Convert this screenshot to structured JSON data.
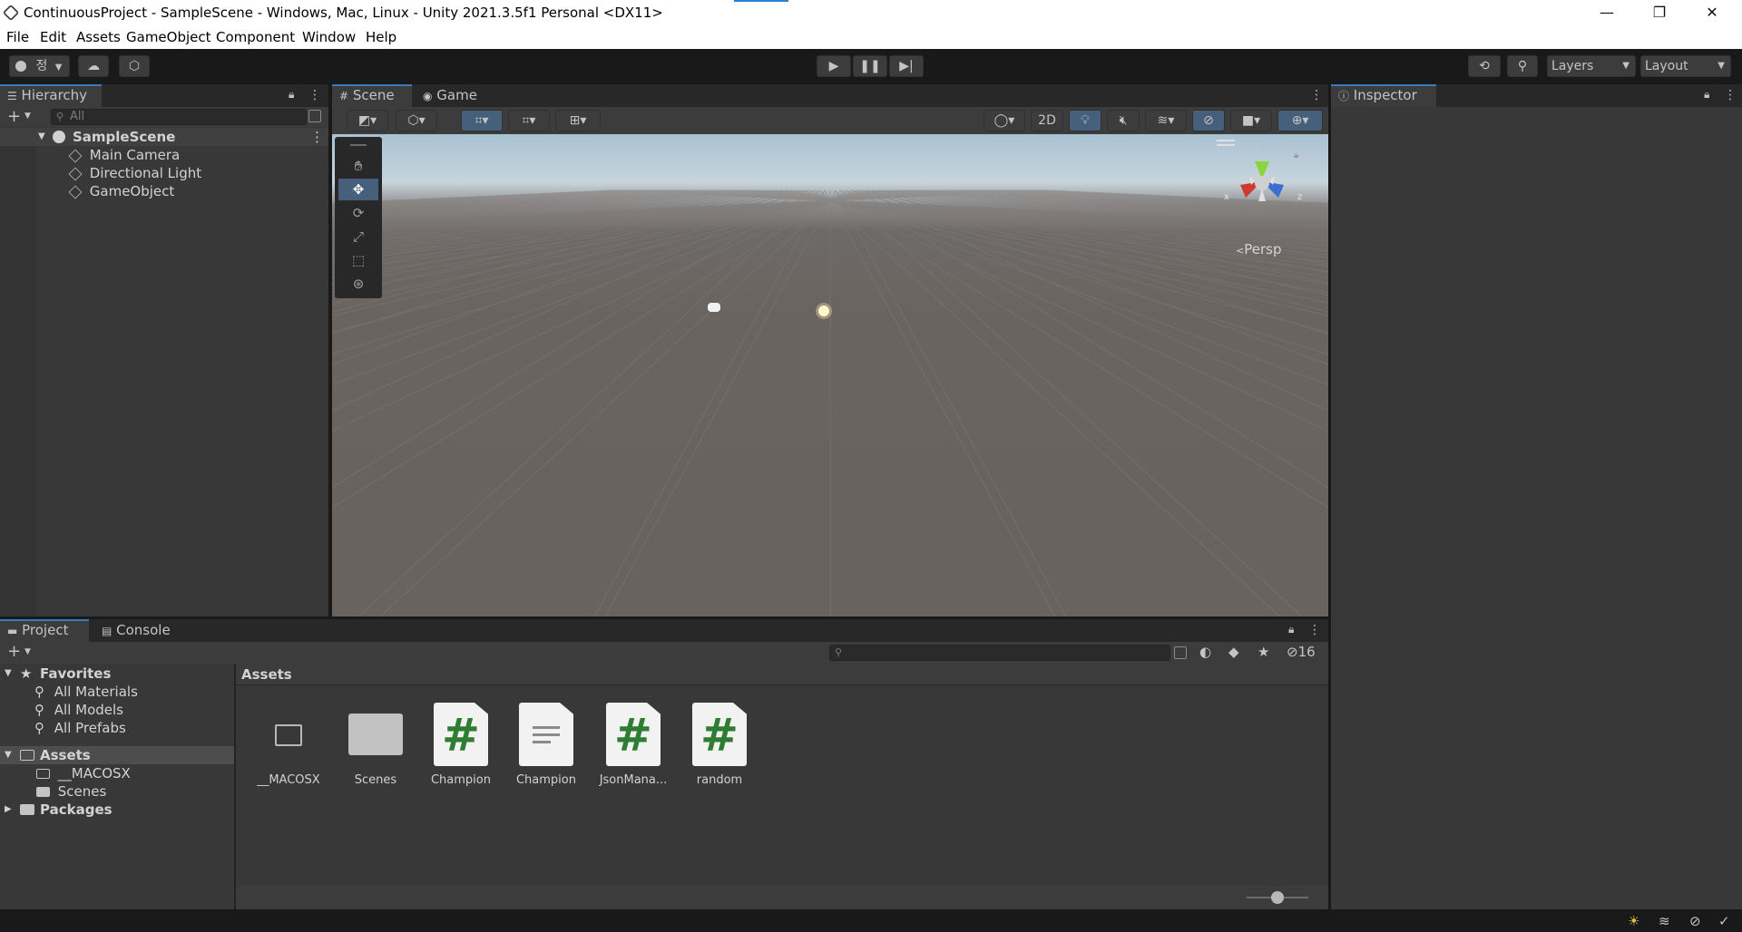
{
  "titlebar": {
    "title": "ContinuousProject - SampleScene - Windows, Mac, Linux - Unity 2021.3.5f1 Personal <DX11>",
    "minimize": "—",
    "restore": "❐",
    "close": "✕"
  },
  "menubar": {
    "items": [
      "File",
      "Edit",
      "Assets",
      "GameObject",
      "Component",
      "Window",
      "Help"
    ]
  },
  "toolbar": {
    "account_label": "정",
    "layers_label": "Layers",
    "layout_label": "Layout"
  },
  "hierarchy": {
    "tab_label": "Hierarchy",
    "search_placeholder": "All",
    "scene_name": "SampleScene",
    "objects": [
      "Main Camera",
      "Directional Light",
      "GameObject"
    ]
  },
  "scene": {
    "tab_scene": "Scene",
    "tab_game": "Game",
    "btn_2d": "2D",
    "persp_label": "Persp",
    "gizmo_y": "y",
    "gizmo_x": "x",
    "gizmo_z": "z"
  },
  "inspector": {
    "tab_label": "Inspector"
  },
  "project": {
    "tab_project": "Project",
    "tab_console": "Console",
    "hidden_count": "16",
    "breadcrumb": "Assets",
    "favorites_label": "Favorites",
    "favorites": [
      "All Materials",
      "All Models",
      "All Prefabs"
    ],
    "assets_label": "Assets",
    "asset_folders": [
      "__MACOSX",
      "Scenes"
    ],
    "packages_label": "Packages",
    "grid": [
      {
        "name": "__MACOSX",
        "kind": "folder-empty"
      },
      {
        "name": "Scenes",
        "kind": "folder"
      },
      {
        "name": "Champion",
        "kind": "script"
      },
      {
        "name": "Champion",
        "kind": "text"
      },
      {
        "name": "JsonMana...",
        "kind": "script"
      },
      {
        "name": "random",
        "kind": "script"
      }
    ],
    "zoom_level": 0.5
  },
  "colors": {
    "accent": "#3a79bb",
    "panel": "#383838",
    "dark": "#191919",
    "script_hash": "#2e7d32"
  }
}
